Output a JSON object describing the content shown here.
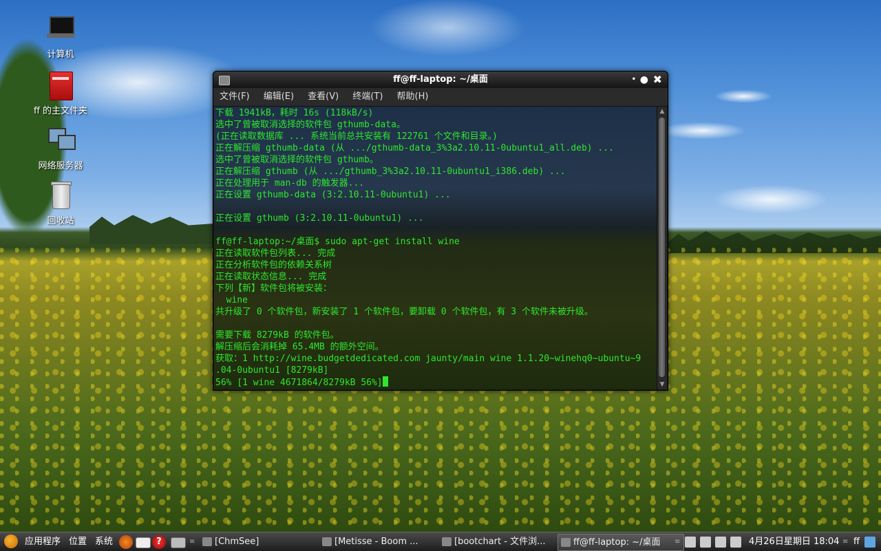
{
  "desktop": {
    "icons": [
      {
        "label": "计算机",
        "icon": "computer-icon"
      },
      {
        "label": "ff 的主文件夹",
        "icon": "home-folder-icon"
      },
      {
        "label": "网络服务器",
        "icon": "network-icon"
      },
      {
        "label": "回收站",
        "icon": "trash-icon"
      }
    ]
  },
  "terminal": {
    "title": "ff@ff-laptop: ~/桌面",
    "window_buttons": {
      "minimize": "•",
      "maximize": "●",
      "close": "✖"
    },
    "menu": [
      {
        "label": "文件(F)"
      },
      {
        "label": "编辑(E)"
      },
      {
        "label": "查看(V)"
      },
      {
        "label": "终端(T)"
      },
      {
        "label": "帮助(H)"
      }
    ],
    "lines": [
      "下载 1941kB，耗时 16s (118kB/s)",
      "选中了曾被取消选择的软件包 gthumb-data。",
      "(正在读取数据库 ... 系统当前总共安装有 122761 个文件和目录。)",
      "正在解压缩 gthumb-data (从 .../gthumb-data_3%3a2.10.11-0ubuntu1_all.deb) ...",
      "选中了曾被取消选择的软件包 gthumb。",
      "正在解压缩 gthumb (从 .../gthumb_3%3a2.10.11-0ubuntu1_i386.deb) ...",
      "正在处理用于 man-db 的触发器...",
      "正在设置 gthumb-data (3:2.10.11-0ubuntu1) ...",
      "",
      "正在设置 gthumb (3:2.10.11-0ubuntu1) ...",
      "",
      "ff@ff-laptop:~/桌面$ sudo apt-get install wine",
      "正在读取软件包列表... 完成",
      "正在分析软件包的依赖关系树",
      "正在读取状态信息... 完成",
      "下列【新】软件包将被安装：",
      "  wine",
      "共升级了 0 个软件包，新安装了 1 个软件包，要卸载 0 个软件包，有 3 个软件未被升级。",
      "",
      "需要下载 8279kB 的软件包。",
      "解压缩后会消耗掉 65.4MB 的额外空间。",
      "获取：1 http://wine.budgetdedicated.com jaunty/main wine 1.1.20~winehq0~ubuntu~9",
      ".04-0ubuntu1 [8279kB]",
      "56% [1 wine 4671864/8279kB 56%]"
    ],
    "scroll_up": "▲",
    "scroll_down": "▼"
  },
  "taskbar": {
    "menus": [
      "应用程序",
      "位置",
      "系统"
    ],
    "launchers": [
      "firefox-icon",
      "mail-icon",
      "help-icon",
      "screenshot-icon"
    ],
    "help_glyph": "?",
    "separator": "≡",
    "tasks": [
      {
        "label": "[ChmSee]"
      },
      {
        "label": "[Metisse - Boom ..."
      },
      {
        "label": "[bootchart - 文件浏..."
      },
      {
        "label": "ff@ff-laptop: ~/桌面"
      }
    ],
    "clock": "4月26日星期日 18:04",
    "user": "ff"
  }
}
